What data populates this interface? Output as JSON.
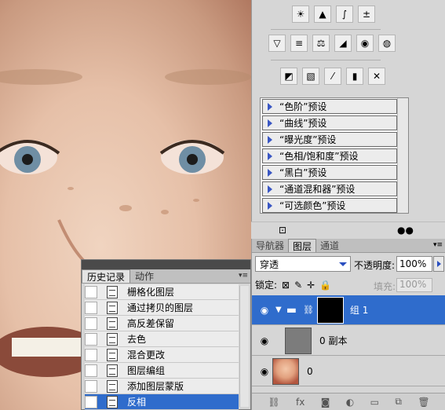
{
  "adjustments": {
    "icon_rows": [
      [
        "brightness-icon",
        "levels-icon",
        "curves-icon",
        "exposure-icon"
      ],
      [
        "vibrance-icon",
        "hue-saturation-icon",
        "color-balance-icon",
        "black-white-icon",
        "photo-filter-icon",
        "channel-mixer-icon"
      ],
      [
        "invert-icon",
        "posterize-icon",
        "threshold-icon",
        "gradient-map-icon",
        "selective-color-icon"
      ]
    ],
    "presets": [
      "“色阶”预设",
      "“曲线”预设",
      "“曝光度”预设",
      "“色相/饱和度”预设",
      "“黑白”预设",
      "“通道混和器”预设",
      "“可选颜色”预设"
    ]
  },
  "history": {
    "tabs": [
      "历史记录",
      "动作"
    ],
    "items": [
      "栅格化图层",
      "通过拷贝的图层",
      "高反差保留",
      "去色",
      "混合更改",
      "图层编组",
      "添加图层蒙版",
      "反相"
    ],
    "selected_index": 7
  },
  "layers": {
    "tabs": [
      "导航器",
      "图层",
      "通道"
    ],
    "active_tab": "图层",
    "blend_mode": "穿透",
    "opacity_label": "不透明度:",
    "opacity_value": "100%",
    "lock_label": "锁定:",
    "fill_label": "填充:",
    "fill_value": "100%",
    "rows": [
      {
        "name": "组 1",
        "type": "group",
        "selected": true
      },
      {
        "name": "0 副本",
        "type": "layer",
        "selected": false
      },
      {
        "name": "0",
        "type": "photo",
        "selected": false
      }
    ]
  },
  "colors": {
    "selection": "#2f6ccc",
    "panel_bg": "#d6d6d6",
    "triangle": "#3a57c4"
  }
}
